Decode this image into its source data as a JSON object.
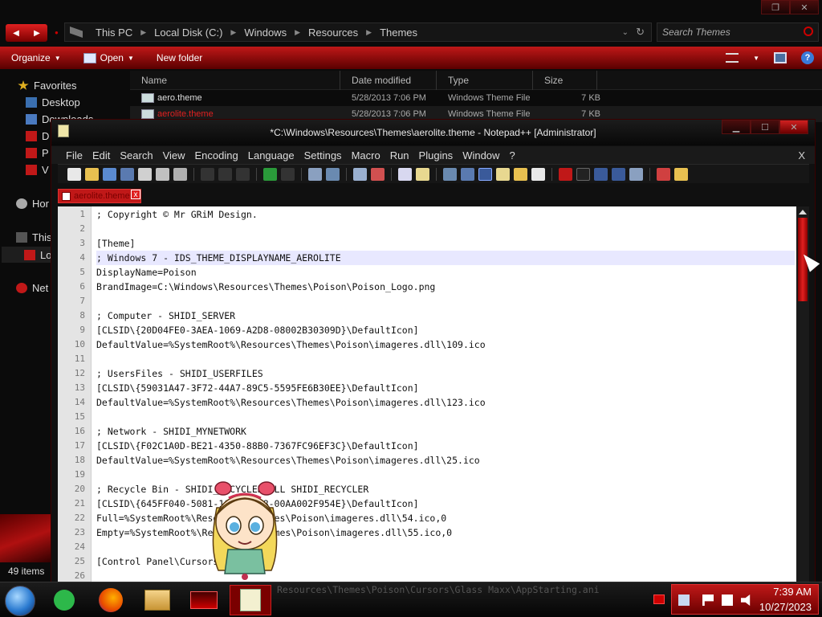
{
  "explorer": {
    "breadcrumbs": [
      "This PC",
      "Local Disk (C:)",
      "Windows",
      "Resources",
      "Themes"
    ],
    "search_placeholder": "Search Themes",
    "commands": {
      "organize": "Organize",
      "open": "Open",
      "new_folder": "New folder"
    },
    "nav": {
      "favorites": "Favorites",
      "desktop": "Desktop",
      "downloads": "Downloads",
      "truncated_1": "D",
      "truncated_2": "P",
      "truncated_3": "V",
      "homegroup": "Hor",
      "this_pc": "This",
      "local_disk": "Lo",
      "network": "Net"
    },
    "columns": {
      "name": "Name",
      "date": "Date modified",
      "type": "Type",
      "size": "Size"
    },
    "files": [
      {
        "name": "aero.theme",
        "date": "5/28/2013 7:06 PM",
        "type": "Windows Theme File",
        "size": "7 KB"
      },
      {
        "name": "aerolite.theme",
        "date": "5/28/2013 7:06 PM",
        "type": "Windows Theme File",
        "size": "7 KB"
      }
    ],
    "status": "49 items"
  },
  "notepad": {
    "title": "*C:\\Windows\\Resources\\Themes\\aerolite.theme - Notepad++ [Administrator]",
    "menu": [
      "File",
      "Edit",
      "Search",
      "View",
      "Encoding",
      "Language",
      "Settings",
      "Macro",
      "Run",
      "Plugins",
      "Window",
      "?"
    ],
    "menu_close": "X",
    "tab_label": "aerolite.theme",
    "tab_close": "x",
    "line_numbers": [
      "1",
      "2",
      "3",
      "4",
      "5",
      "6",
      "7",
      "8",
      "9",
      "10",
      "11",
      "12",
      "13",
      "14",
      "15",
      "16",
      "17",
      "18",
      "19",
      "20",
      "21",
      "22",
      "23",
      "24",
      "25",
      "26"
    ],
    "lines": [
      "; Copyright © Mr GRiM Design.",
      "",
      "[Theme]",
      "; Windows 7 - IDS_THEME_DISPLAYNAME_AEROLITE",
      "DisplayName=Poison",
      "BrandImage=C:\\Windows\\Resources\\Themes\\Poison\\Poison_Logo.png",
      "",
      "; Computer - SHIDI_SERVER",
      "[CLSID\\{20D04FE0-3AEA-1069-A2D8-08002B30309D}\\DefaultIcon]",
      "DefaultValue=%SystemRoot%\\Resources\\Themes\\Poison\\imageres.dll\\109.ico",
      "",
      "; UsersFiles - SHIDI_USERFILES",
      "[CLSID\\{59031A47-3F72-44A7-89C5-5595FE6B30EE}\\DefaultIcon]",
      "DefaultValue=%SystemRoot%\\Resources\\Themes\\Poison\\imageres.dll\\123.ico",
      "",
      "; Network - SHIDI_MYNETWORK",
      "[CLSID\\{F02C1A0D-BE21-4350-88B0-7367FC96EF3C}\\DefaultIcon]",
      "DefaultValue=%SystemRoot%\\Resources\\Themes\\Poison\\imageres.dll\\25.ico",
      "",
      "; Recycle Bin - SHIDI_RECYCLERFULL SHIDI_RECYCLER",
      "[CLSID\\{645FF040-5081-101B-9F08-00AA002F954E}\\DefaultIcon]",
      "Full=%SystemRoot%\\Resources\\Themes\\Poison\\imageres.dll\\54.ico,0",
      "Empty=%SystemRoot%\\Resources\\Themes\\Poison\\imageres.dll\\55.ico,0",
      "",
      "[Control Panel\\Cursors]",
      ""
    ]
  },
  "taskbar": {
    "behind_text": "Resources\\Themes\\Poison\\Cursors\\Glass Maxx\\AppStarting.ani",
    "time": "7:39 AM",
    "date": "10/27/2023",
    "apps": [
      "start-orb",
      "notes",
      "firefox",
      "file-explorer",
      "red-app",
      "notepad++"
    ]
  },
  "colors": {
    "accent": "#c01818",
    "dark_accent": "#5a0000",
    "background": "#0b0b0b"
  }
}
